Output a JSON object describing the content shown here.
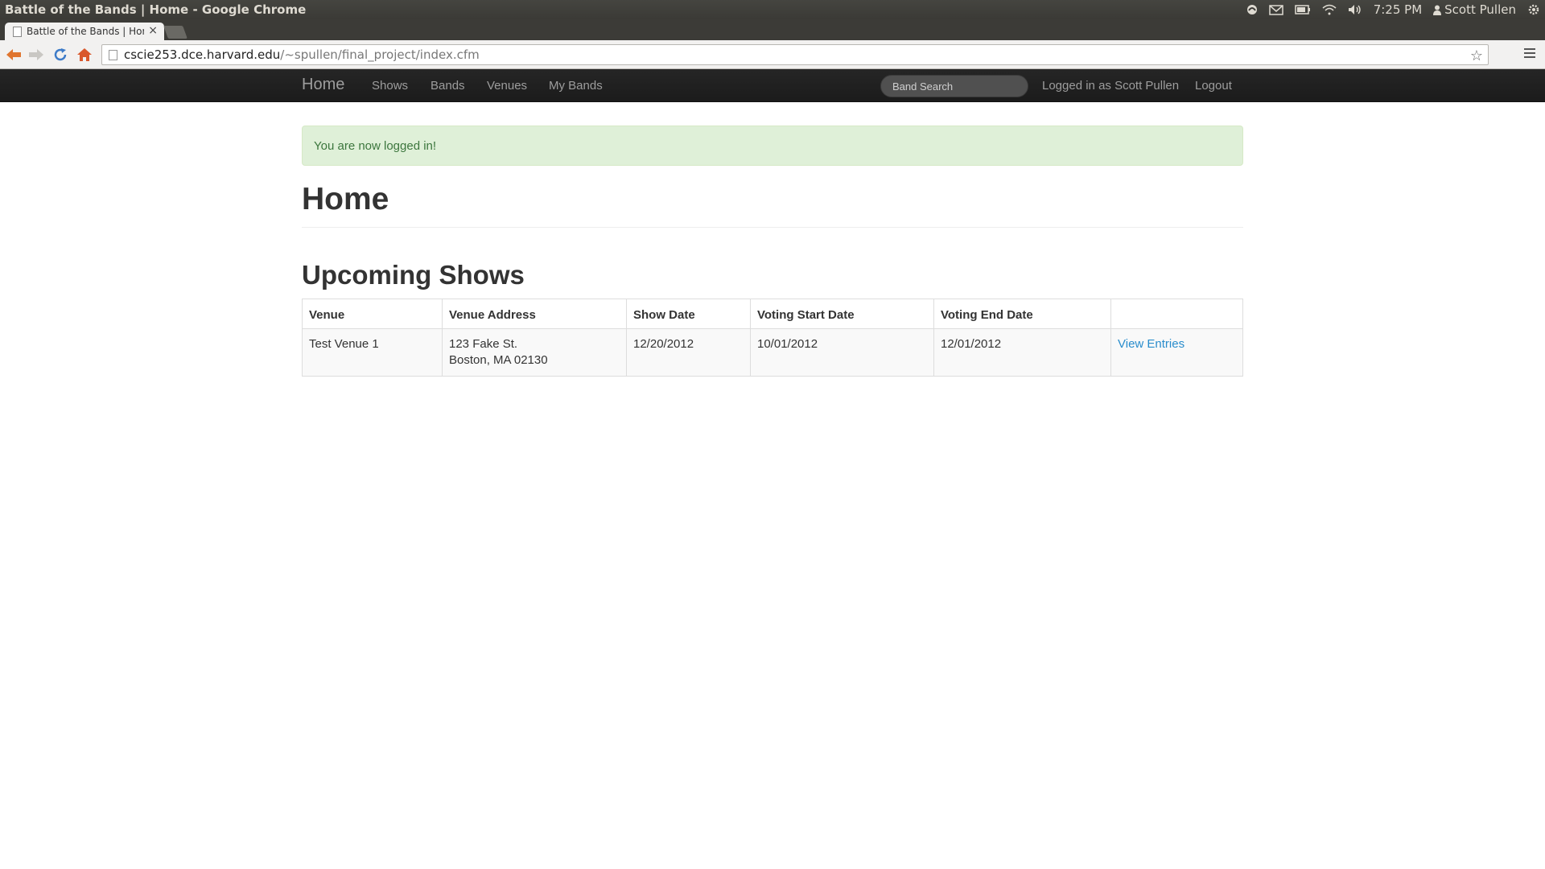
{
  "window": {
    "title": "Battle of the Bands | Home - Google Chrome",
    "clock": "7:25 PM",
    "user": "Scott Pullen"
  },
  "tab": {
    "title": "Battle of the Bands | Home",
    "close": "×"
  },
  "address": {
    "host": "cscie253.dce.harvard.edu",
    "path": "/~spullen/final_project/index.cfm"
  },
  "nav": {
    "brand": "Home",
    "links": [
      "Shows",
      "Bands",
      "Venues",
      "My Bands"
    ],
    "search_placeholder": "Band Search",
    "logged_in": "Logged in as Scott Pullen",
    "logout": "Logout"
  },
  "alert": {
    "text": "You are now logged in!"
  },
  "page": {
    "title": "Home",
    "section_title": "Upcoming Shows"
  },
  "table": {
    "headers": [
      "Venue",
      "Venue Address",
      "Show Date",
      "Voting Start Date",
      "Voting End Date",
      ""
    ],
    "rows": [
      {
        "venue": "Test Venue 1",
        "address_line1": "123 Fake St.",
        "address_line2": "Boston, MA 02130",
        "show_date": "12/20/2012",
        "voting_start": "10/01/2012",
        "voting_end": "12/01/2012",
        "action": "View Entries"
      }
    ]
  },
  "colors": {
    "navbar_bg": "#222222",
    "alert_bg": "#dff0d8",
    "alert_text": "#3c763d",
    "link": "#2a8dcc"
  }
}
